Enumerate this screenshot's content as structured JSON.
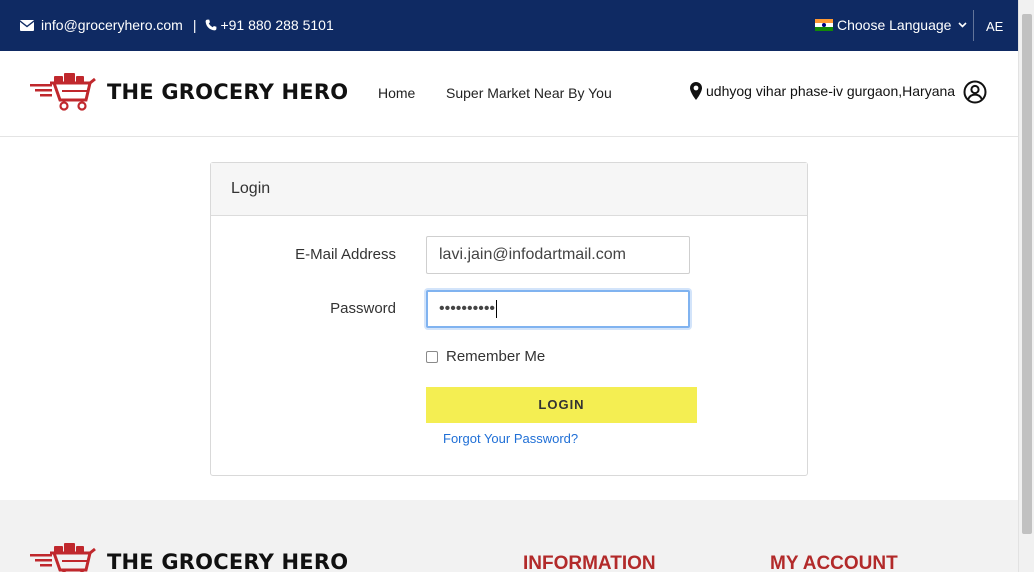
{
  "topbar": {
    "email": "info@groceryhero.com",
    "separator": "|",
    "phone": "+91 880 288 5101",
    "language_label": "Choose Language",
    "region": "AE"
  },
  "header": {
    "logo_text": "THE GROCERY HERO",
    "nav": [
      {
        "label": "Home"
      },
      {
        "label": "Super Market Near By You"
      }
    ],
    "location": "udhyog vihar phase-iv gurgaon,Haryana"
  },
  "login": {
    "title": "Login",
    "email_label": "E-Mail Address",
    "email_value": "lavi.jain@infodartmail.com",
    "password_label": "Password",
    "password_value": "••••••••••",
    "remember_label": "Remember Me",
    "remember_checked": false,
    "login_button": "LOGIN",
    "forgot_link": "Forgot Your Password?"
  },
  "footer": {
    "logo_text": "THE GROCERY HERO",
    "headings": [
      "INFORMATION",
      "MY ACCOUNT"
    ]
  },
  "colors": {
    "topbar_bg": "#0f2a63",
    "brand_red": "#c0282d",
    "login_button": "#f4ee52",
    "link": "#1f6fd6",
    "footer_heading": "#b22a2a"
  },
  "icons": [
    "envelope-icon",
    "phone-icon",
    "india-flag-icon",
    "chevron-down-icon",
    "cart-logo-icon",
    "map-pin-icon",
    "user-circle-icon"
  ]
}
